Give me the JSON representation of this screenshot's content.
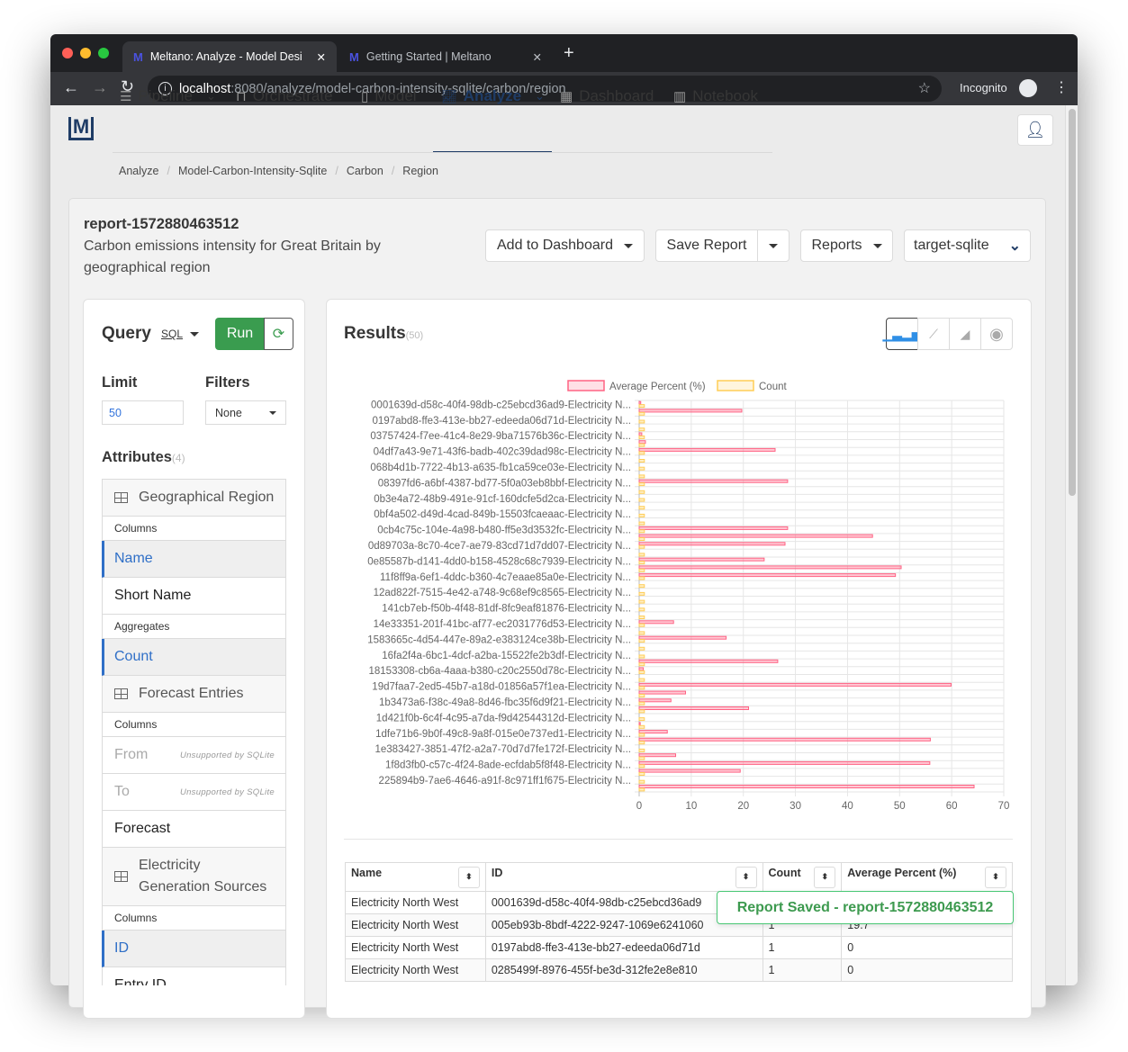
{
  "browser": {
    "tabs": [
      {
        "title": "Meltano: Analyze - Model Desi",
        "active": true
      },
      {
        "title": "Getting Started | Meltano",
        "active": false
      }
    ],
    "url_host": "localhost",
    "url_path": ":8080/analyze/model-carbon-intensity-sqlite/carbon/region",
    "profile": "Incognito"
  },
  "nav": {
    "items": [
      {
        "label": "Pipeline",
        "dropdown": true
      },
      {
        "label": "Orchestrate"
      },
      {
        "label": "Model"
      },
      {
        "label": "Analyze",
        "dropdown": true,
        "active": true
      },
      {
        "label": "Dashboard"
      },
      {
        "label": "Notebook"
      }
    ]
  },
  "breadcrumb": [
    "Analyze",
    "Model-Carbon-Intensity-Sqlite",
    "Carbon",
    "Region"
  ],
  "report": {
    "name": "report-1572880463512",
    "description": "Carbon emissions intensity for Great Britain by geographical region"
  },
  "actions": {
    "add_to_dashboard": "Add to Dashboard",
    "save_report": "Save Report",
    "reports": "Reports",
    "connection": "target-sqlite"
  },
  "query": {
    "title": "Query",
    "mode": "SQL",
    "run": "Run",
    "limit_label": "Limit",
    "limit_value": "50",
    "filters_label": "Filters",
    "filters_value": "None",
    "attributes_label": "Attributes",
    "attributes_count": "(4)"
  },
  "attributes": [
    {
      "type": "head",
      "label": "Geographical Region"
    },
    {
      "type": "sub",
      "label": "Columns"
    },
    {
      "type": "item",
      "label": "Name",
      "selected": true
    },
    {
      "type": "item",
      "label": "Short Name"
    },
    {
      "type": "sub",
      "label": "Aggregates"
    },
    {
      "type": "item",
      "label": "Count",
      "selected": true
    },
    {
      "type": "head",
      "label": "Forecast Entries"
    },
    {
      "type": "sub",
      "label": "Columns"
    },
    {
      "type": "item",
      "label": "From",
      "disabled": true,
      "note": "Unsupported by SQLite"
    },
    {
      "type": "item",
      "label": "To",
      "disabled": true,
      "note": "Unsupported by SQLite"
    },
    {
      "type": "item",
      "label": "Forecast"
    },
    {
      "type": "head",
      "label": "Electricity Generation Sources"
    },
    {
      "type": "sub",
      "label": "Columns"
    },
    {
      "type": "item",
      "label": "ID",
      "selected": true
    },
    {
      "type": "item",
      "label": "Entry ID"
    }
  ],
  "results": {
    "title": "Results",
    "count": "(50)",
    "chart_types": [
      "bar-chart-icon",
      "line-chart-icon",
      "area-chart-icon",
      "pie-chart-icon"
    ],
    "active_chart_type": "bar"
  },
  "chart_data": {
    "type": "bar",
    "orientation": "horizontal",
    "grid": true,
    "legend": "top",
    "series": [
      {
        "name": "Average Percent (%)",
        "color": "#ff6384",
        "values": [
          0.3,
          19.7,
          0,
          0,
          0.5,
          1.2,
          26.1,
          0,
          0,
          0,
          28.5,
          0,
          0,
          0,
          0,
          0,
          28.5,
          44.8,
          28,
          0,
          24,
          50.3,
          49.2,
          0,
          0,
          0,
          0,
          0,
          6.6,
          0,
          16.7,
          0,
          0,
          26.6,
          0.8,
          0,
          59.9,
          8.9,
          6.1,
          21.0,
          0,
          0.2,
          5.4,
          55.9,
          0,
          7,
          55.8,
          19.4,
          0,
          64.3
        ]
      },
      {
        "name": "Count",
        "color": "#ffcd56",
        "values": [
          1,
          1,
          1,
          1,
          1,
          1,
          1,
          1,
          1,
          1,
          1,
          1,
          1,
          1,
          1,
          1,
          1,
          1,
          1,
          1,
          1,
          1,
          1,
          1,
          1,
          1,
          1,
          1,
          1,
          1,
          1,
          1,
          1,
          1,
          1,
          1,
          1,
          1,
          1,
          1,
          1,
          1,
          1,
          1,
          1,
          1,
          1,
          1,
          1,
          1
        ]
      }
    ],
    "tick_labels": [
      "0001639d-d58c-40f4-98db-c25ebcd36ad9-Electricity N...",
      "0197abd8-ffe3-413e-bb27-edeeda06d71d-Electricity N...",
      "03757424-f7ee-41c4-8e29-9ba71576b36c-Electricity N...",
      "04df7a43-9e71-43f6-badb-402c39dad98c-Electricity N...",
      "068b4d1b-7722-4b13-a635-fb1ca59ce03e-Electricity N...",
      "08397fd6-a6bf-4387-bd77-5f0a03eb8bbf-Electricity N...",
      "0b3e4a72-48b9-491e-91cf-160dcfe5d2ca-Electricity N...",
      "0bf4a502-d49d-4cad-849b-15503fcaeaac-Electricity N...",
      "0cb4c75c-104e-4a98-b480-ff5e3d3532fc-Electricity N...",
      "0d89703a-8c70-4ce7-ae79-83cd71d7dd07-Electricity N...",
      "0e85587b-d141-4dd0-b158-4528c68c7939-Electricity N...",
      "11f8ff9a-6ef1-4ddc-b360-4c7eaae85a0e-Electricity N...",
      "12ad822f-7515-4e42-a748-9c68ef9c8565-Electricity N...",
      "141cb7eb-f50b-4f48-81df-8fc9eaf81876-Electricity N...",
      "14e33351-201f-41bc-af77-ec2031776d53-Electricity N...",
      "1583665c-4d54-447e-89a2-e383124ce38b-Electricity N...",
      "16fa2f4a-6bc1-4dcf-a2ba-15522fe2b3df-Electricity N...",
      "18153308-cb6a-4aaa-b380-c20c2550d78c-Electricity N...",
      "19d7faa7-2ed5-45b7-a18d-01856a57f1ea-Electricity N...",
      "1b3473a6-f38c-49a8-8d46-fbc35f6d9f21-Electricity N...",
      "1d421f0b-6c4f-4c95-a7da-f9d42544312d-Electricity N...",
      "1dfe71b6-9b0f-49c8-9a8f-015e0e737ed1-Electricity N...",
      "1e383427-3851-47f2-a2a7-70d7d7fe172f-Electricity N...",
      "1f8d3fb0-c57c-4f24-8ade-ecfdab5f8f48-Electricity N...",
      "225894b9-7ae6-4646-a91f-8c971ff1f675-Electricity N..."
    ],
    "xlim": [
      0,
      70
    ],
    "x_ticks": [
      0,
      10,
      20,
      30,
      40,
      50,
      60,
      70
    ]
  },
  "table": {
    "columns": [
      "Name",
      "ID",
      "Count",
      "Average Percent (%)"
    ],
    "rows": [
      [
        "Electricity North West",
        "0001639d-d58c-40f4-98db-c25ebcd36ad9",
        "",
        ""
      ],
      [
        "Electricity North West",
        "005eb93b-8bdf-4222-9247-1069e6241060",
        "1",
        "19.7"
      ],
      [
        "Electricity North West",
        "0197abd8-ffe3-413e-bb27-edeeda06d71d",
        "1",
        "0"
      ],
      [
        "Electricity North West",
        "0285499f-8976-455f-be3d-312fe2e8e810",
        "1",
        "0"
      ]
    ]
  },
  "toast": "Report Saved - report-1572880463512"
}
